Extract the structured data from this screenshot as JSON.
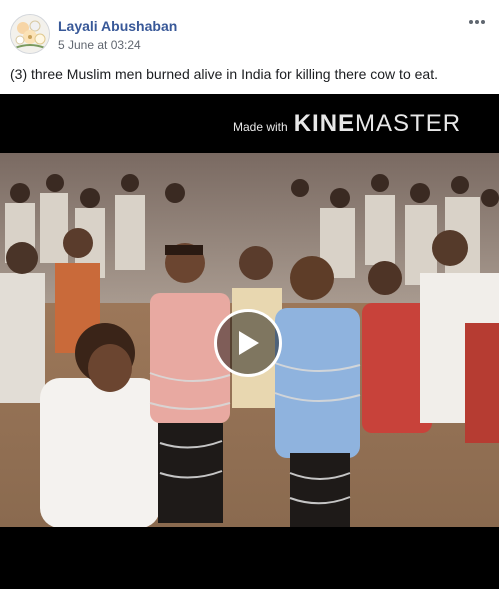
{
  "post": {
    "author": "Layali Abushaban",
    "timestamp": "5 June at 03:24",
    "caption": "(3) three Muslim men burned alive in India for killing there cow to eat.",
    "more_icon": "ellipsis-icon",
    "avatar_icon": "avatar-image"
  },
  "video": {
    "watermark_prefix": "Made with",
    "watermark_brand_bold": "KINE",
    "watermark_brand_light": "MASTER",
    "play_icon": "play-icon"
  },
  "colors": {
    "author_link": "#385898",
    "meta_text": "#616770",
    "body_text": "#1c1e21",
    "video_bg": "#000000"
  }
}
